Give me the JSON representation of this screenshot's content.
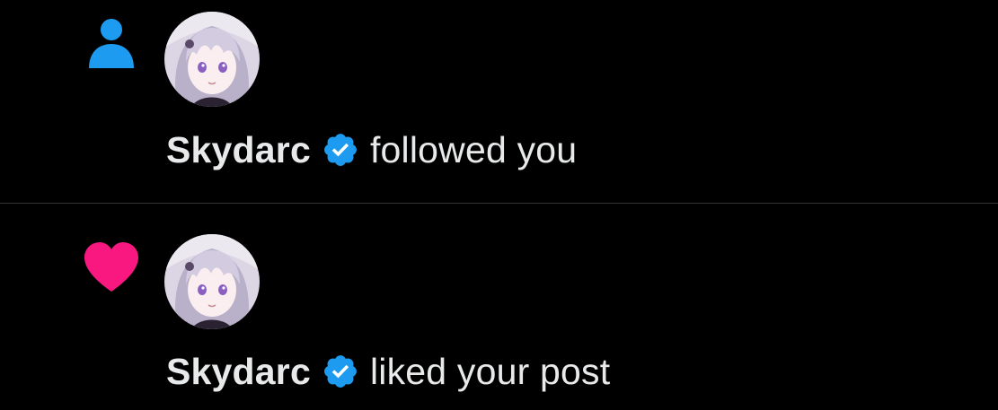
{
  "notifications": [
    {
      "type": "follow",
      "type_icon": "person-icon",
      "username": "Skydarc",
      "verified": true,
      "action": "followed you"
    },
    {
      "type": "like",
      "type_icon": "heart-icon",
      "username": "Skydarc",
      "verified": true,
      "action": "liked your post"
    }
  ],
  "colors": {
    "background": "#000000",
    "text": "#e7e9ea",
    "follow_icon": "#1d9bf0",
    "like_icon": "#f91880",
    "verified_badge": "#1d9bf0",
    "divider": "#2f3336"
  }
}
